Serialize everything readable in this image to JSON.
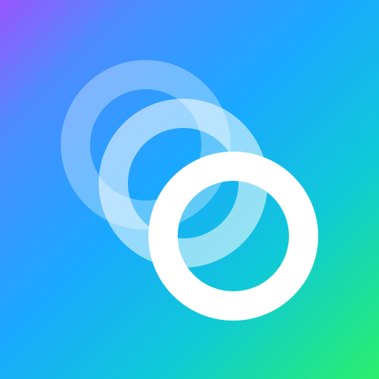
{
  "app_icon": {
    "icon": "animated-rings-icon",
    "colors": {
      "gradient_top_left": "#9a55ff",
      "gradient_center": "#1aa8ff",
      "gradient_bottom_right": "#29f06b",
      "ring": "#ffffff"
    },
    "ring_opacities": [
      0.32,
      0.55,
      1.0
    ]
  }
}
